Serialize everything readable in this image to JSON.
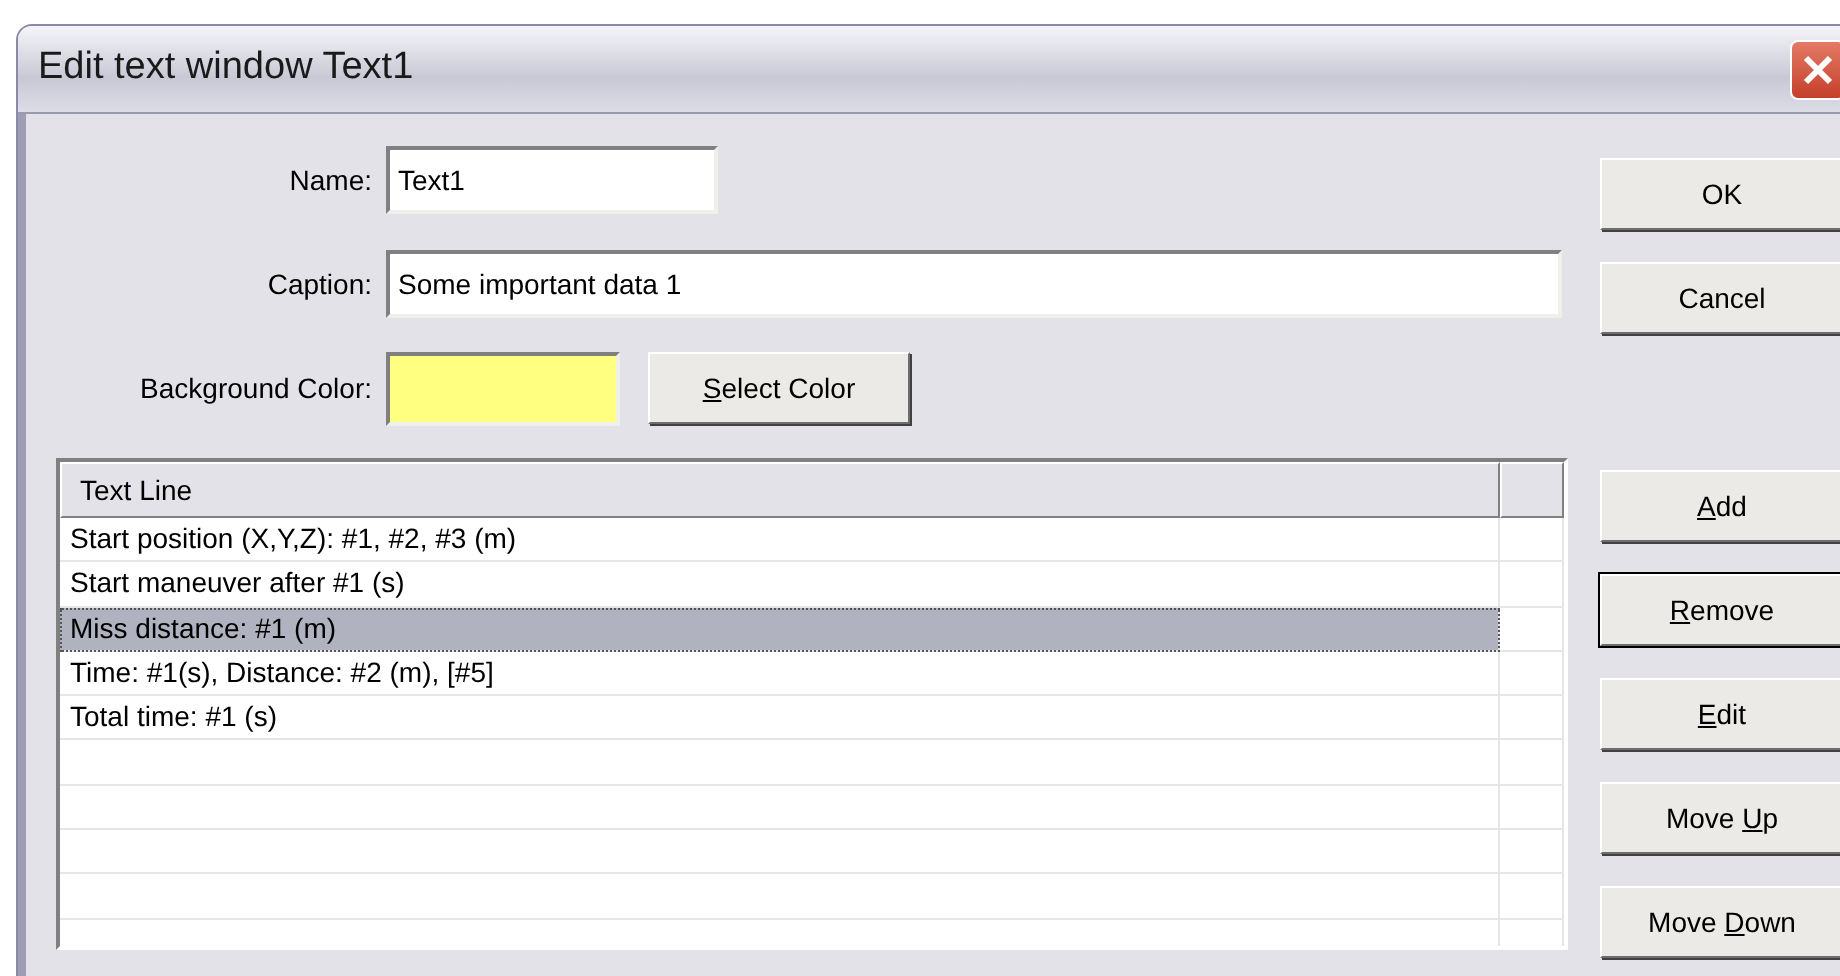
{
  "window": {
    "title": "Edit text window Text1"
  },
  "fields": [
    {
      "kind": "text",
      "label": "Name:",
      "value": "Text1"
    },
    {
      "kind": "text",
      "label": "Caption:",
      "value": "Some important data 1"
    },
    {
      "kind": "color",
      "label": "Background Color:",
      "color": "#ffff80",
      "button": {
        "access_key": "S",
        "rest": "elect Color"
      }
    }
  ],
  "list": {
    "columns": [
      "Text Line"
    ],
    "rows": [
      {
        "text": "Start position (X,Y,Z): #1, #2, #3 (m)",
        "selected": false
      },
      {
        "text": "Start maneuver after #1 (s)",
        "selected": false
      },
      {
        "text": "Miss distance: #1 (m)",
        "selected": true
      },
      {
        "text": "Time: #1(s), Distance: #2 (m), [#5]",
        "selected": false
      },
      {
        "text": "Total time: #1 (s)",
        "selected": false
      }
    ]
  },
  "buttons": [
    {
      "rest": "OK",
      "default": false
    },
    {
      "rest": "Cancel",
      "default": false
    },
    {
      "access_key": "A",
      "rest": "dd",
      "default": false
    },
    {
      "access_key": "R",
      "rest": "emove",
      "default": true
    },
    {
      "access_key": "E",
      "rest": "dit",
      "default": false
    },
    {
      "before": "Move ",
      "access_key": "U",
      "rest": "p",
      "default": false
    },
    {
      "before": "Move ",
      "access_key": "D",
      "rest": "own",
      "default": false
    }
  ]
}
